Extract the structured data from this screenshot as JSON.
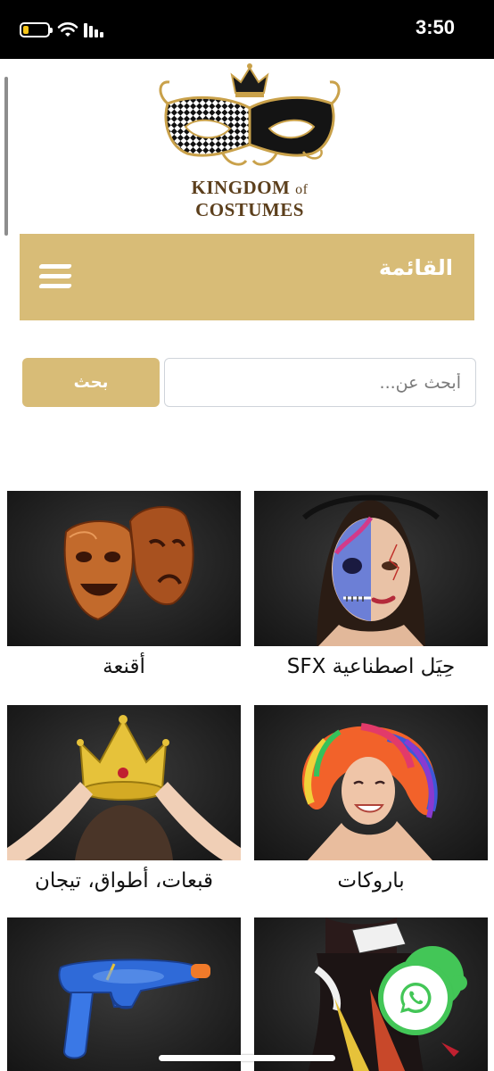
{
  "status_bar": {
    "time": "3:50",
    "icons": [
      "battery-icon",
      "wifi-icon",
      "signal-icon"
    ]
  },
  "logo": {
    "brand_main": "KINGDOM",
    "brand_of": "of",
    "brand_end": "COSTUMES"
  },
  "menu": {
    "label": "القائمة",
    "icon": "hamburger-icon"
  },
  "search": {
    "placeholder": "أبحث عن...",
    "value": "",
    "button_label": "بحث"
  },
  "categories": [
    {
      "label": "حِيَل اصطناعية SFX",
      "image": "face-paint-image"
    },
    {
      "label": "أقنعة",
      "image": "theater-masks-image"
    },
    {
      "label": "باروكات",
      "image": "rainbow-wig-image"
    },
    {
      "label": "قبعات، أطواق، تيجان",
      "image": "gold-crown-image"
    },
    {
      "label": "",
      "image": "costume-image"
    },
    {
      "label": "",
      "image": "water-gun-image"
    }
  ],
  "floating_action": {
    "icon": "whatsapp-icon"
  },
  "colors": {
    "brand_gold": "#d8bc77",
    "whatsapp_green": "#43c657",
    "logo_text": "#5c3f1c"
  }
}
